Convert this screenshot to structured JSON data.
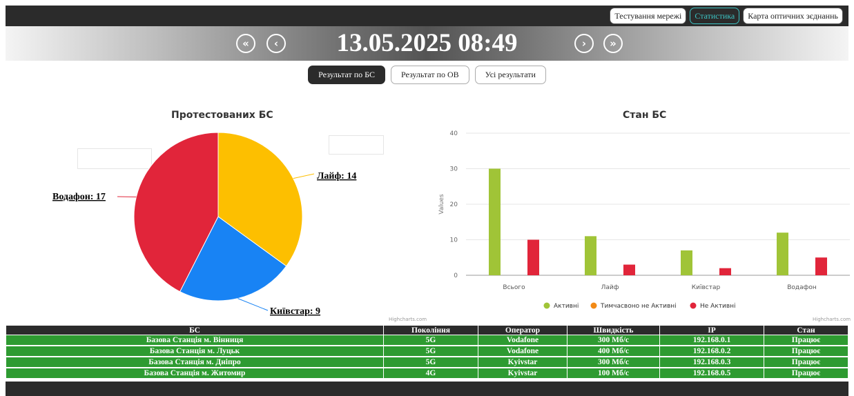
{
  "nav": [
    "Тестування мережі",
    "Статистика",
    "Карта оптичних зєднаннь"
  ],
  "date_time": "13.05.2025 08:49",
  "tabs": [
    "Результат по БС",
    "Результат по ОВ",
    "Усі результати"
  ],
  "colors": {
    "lime": "#a0c437",
    "red": "#e1253a",
    "orange": "#f28a16",
    "yellow": "#fdbf00",
    "blue": "#1883f4",
    "table_green": "#2e9b31",
    "dark": "#2b2b2b",
    "accent_teal": "#3cc4c4"
  },
  "credits": "Highcharts.com",
  "chart_data": [
    {
      "type": "pie",
      "title": "Протестованих БС",
      "slices": [
        {
          "label": "Лайф: 14",
          "value": 14,
          "color": "#fdbf00"
        },
        {
          "label": "Київстар: 9",
          "value": 9,
          "color": "#1883f4"
        },
        {
          "label": "Водафон: 17",
          "value": 17,
          "color": "#e1253a"
        }
      ]
    },
    {
      "type": "bar",
      "title": "Стан БС",
      "ylabel": "Values",
      "ylim": [
        0,
        40
      ],
      "yticks": [
        0,
        10,
        20,
        30,
        40
      ],
      "categories": [
        "Всього",
        "Лайф",
        "Київстар",
        "Водафон"
      ],
      "series": [
        {
          "name": "Активні",
          "color": "#a0c437",
          "values": [
            30,
            11,
            7,
            12
          ]
        },
        {
          "name": "Тимчасвоно не Активні",
          "color": "#f28a16",
          "values": [
            0,
            0,
            0,
            0
          ]
        },
        {
          "name": "Не Активні",
          "color": "#e1253a",
          "values": [
            10,
            3,
            2,
            5
          ]
        }
      ],
      "legend": "bottom",
      "grid": true
    }
  ],
  "table": {
    "headers": [
      "БС",
      "Покоління",
      "Оператор",
      "Швидкість",
      "IP",
      "Стан"
    ],
    "rows": [
      [
        "Базова Станція м. Вінниця",
        "5G",
        "Vodafone",
        "300 Мб/с",
        "192.168.0.1",
        "Працює"
      ],
      [
        "Базова Станція м. Луцьк",
        "5G",
        "Vodafone",
        "400 Мб/с",
        "192.168.0.2",
        "Працює"
      ],
      [
        "Базова Станція м. Дніпро",
        "5G",
        "Kyivstar",
        "300 Мб/с",
        "192.168.0.3",
        "Працює"
      ],
      [
        "Базова Станція м. Житомир",
        "4G",
        "Kyivstar",
        "100 Мб/с",
        "192.168.0.5",
        "Працює"
      ]
    ]
  }
}
